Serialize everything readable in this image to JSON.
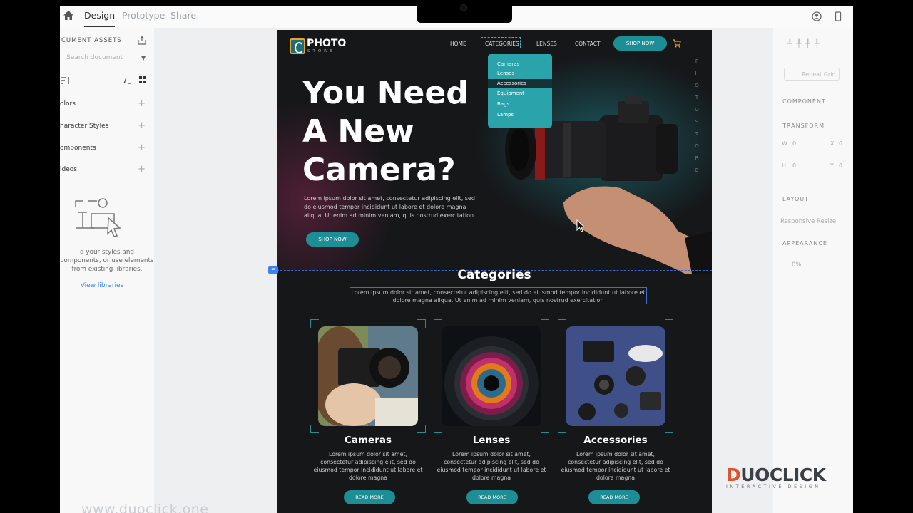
{
  "editor": {
    "tabs": [
      "Design",
      "Prototype",
      "Share"
    ],
    "active_tab": "Design"
  },
  "left_panel": {
    "title": "CUMENT ASSETS",
    "search_placeholder": "Search document",
    "sections": [
      "olors",
      "haracter Styles",
      "omponents",
      "ideos"
    ],
    "help_text": "d your styles and components, or use elements from existing libraries.",
    "link": "View libraries"
  },
  "right_panel": {
    "repeat_grid": "Repeat Grid",
    "component": "COMPONENT",
    "transform": "TRANSFORM",
    "w_label": "W",
    "w_value": "0",
    "x_label": "X",
    "x_value": "0",
    "h_label": "H",
    "h_value": "0",
    "y_label": "Y",
    "y_value": "0",
    "layout": "LAYOUT",
    "responsive": "Responsive Resize",
    "appearance": "APPEARANCE",
    "opacity": "0%"
  },
  "site": {
    "logo_text": "PHOTO",
    "logo_sub": "STORE",
    "nav": [
      "HOME",
      "CATEGORIES",
      "LENSES",
      "CONTACT"
    ],
    "shop_now": "SHOP NOW",
    "dropdown": [
      "Cameras",
      "Lenses",
      "Accessories",
      "Equipment",
      "Bags",
      "Lamps"
    ],
    "dropdown_selected": "Accessories",
    "hero_title_1": "You Need",
    "hero_title_2": "A New",
    "hero_title_3": "Camera?",
    "hero_body": "Lorem ipsum dolor sit amet, consectetur adipiscing elit, sed do eiusmod tempor incididunt ut labore et dolore magna aliqua. Ut enim ad minim veniam, quis nostrud exercitation",
    "hero_button": "SHOP NOW",
    "vertical_text": "PHOTOSTORE",
    "categories_title": "Categories",
    "categories_desc": "Lorem ipsum dolor sit amet, consectetur adipiscing elit, sed do eiusmod tempor incididunt ut labore et dolore magna aliqua. Ut enim ad minim veniam, quis nostrud exercitation",
    "cards": [
      {
        "title": "Cameras",
        "body": "Lorem ipsum dolor sit amet, consectetur adipiscing elit, sed do eiusmod tempor incididunt ut labore et dolore magna",
        "button": "READ MORE"
      },
      {
        "title": "Lenses",
        "body": "Lorem ipsum dolor sit amet, consectetur adipiscing elit, sed do eiusmod tempor incididunt ut labore et dolore magna",
        "button": "READ MORE"
      },
      {
        "title": "Accessories",
        "body": "Lorem ipsum dolor sit amet, consectetur adipiscing elit, sed do eiusmod tempor incididunt ut labore et dolore magna",
        "button": "READ MORE"
      }
    ]
  },
  "overlay": {
    "url": "www.duoclick.one",
    "brand_d": "D",
    "brand_rest": "UOCLICK",
    "brand_sub": "INTERACTIVE DESIGN"
  },
  "colors": {
    "accent": "#1d8e96",
    "dropdown": "#2aa3ab",
    "brand_orange": "#e0522b"
  }
}
